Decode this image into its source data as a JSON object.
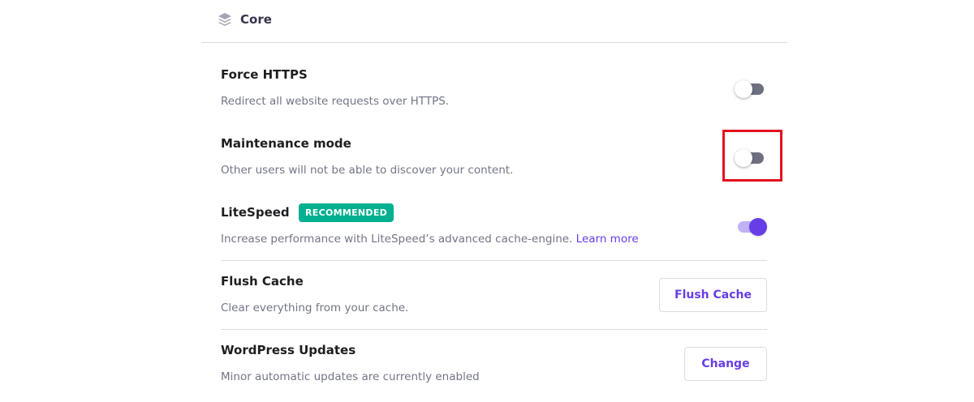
{
  "section": {
    "title": "Core",
    "icon": "layers-icon"
  },
  "settings": {
    "force_https": {
      "name": "Force HTTPS",
      "description": "Redirect all website requests over HTTPS.",
      "enabled": false
    },
    "maintenance": {
      "name": "Maintenance mode",
      "description": "Other users will not be able to discover your content.",
      "enabled": false
    },
    "litespeed": {
      "name": "LiteSpeed",
      "badge": "RECOMMENDED",
      "description": "Increase performance with LiteSpeed’s advanced cache-engine.",
      "link_label": "Learn more",
      "enabled": true
    },
    "flush_cache": {
      "name": "Flush Cache",
      "description": "Clear everything from your cache.",
      "button_label": "Flush Cache"
    },
    "wp_updates": {
      "name": "WordPress Updates",
      "description": "Minor automatic updates are currently enabled",
      "button_label": "Change"
    }
  },
  "colors": {
    "accent": "#673de6",
    "badge": "#00b090",
    "highlight": "#e3101e"
  }
}
